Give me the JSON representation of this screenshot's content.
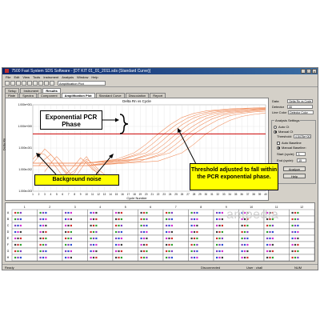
{
  "window": {
    "title": "7500 Fast System SDS Software - [DT KIT 01_01_2011.sds (Standard Curve)]",
    "controls": [
      "_",
      "□",
      "x"
    ]
  },
  "menu": [
    "File",
    "Edit",
    "View",
    "Tools",
    "Instrument",
    "Analysis",
    "Window",
    "Help"
  ],
  "toolbar": {
    "combo_value": "Amplification Plot"
  },
  "tabs_row1": [
    "Setup",
    "Instrument",
    "Results"
  ],
  "tabs_row2": [
    "Plate",
    "Spectra",
    "Component",
    "Amplification Plot",
    "Standard Curve",
    "Dissociation",
    "Report"
  ],
  "active_tab": "Amplification Plot",
  "chart_data": {
    "type": "line",
    "title": "Delta Rn vs Cycle",
    "xlabel": "Cycle Number",
    "ylabel": "Delta Rn",
    "y_scale": "log",
    "ylim": [
      0.001,
      10
    ],
    "y_ticks": [
      "1.000e+001",
      "1.000e+000",
      "1.000e-001",
      "1.000e-002",
      "1.000e-003"
    ],
    "x_ticks": [
      1,
      2,
      3,
      4,
      5,
      6,
      7,
      8,
      9,
      10,
      11,
      12,
      13,
      14,
      15,
      16,
      17,
      18,
      19,
      20,
      21,
      22,
      23,
      24,
      25,
      26,
      27,
      28,
      29,
      30,
      31,
      32,
      33,
      34,
      35,
      36,
      37,
      38,
      39,
      40
    ],
    "threshold": 0.45,
    "threshold_color": "#cc0000",
    "curve_color": "#f09060",
    "grid": true,
    "series": [
      {
        "x": [
          1,
          5,
          10,
          15,
          18,
          20,
          22,
          24,
          26,
          28,
          30,
          34,
          38,
          40
        ],
        "y": [
          0.02,
          0.02,
          0.02,
          0.03,
          0.06,
          0.15,
          0.45,
          1.2,
          2.6,
          4.0,
          5.2,
          6.5,
          7.2,
          7.4
        ]
      },
      {
        "x": [
          1,
          5,
          10,
          15,
          19,
          21,
          23,
          25,
          27,
          29,
          31,
          35,
          38,
          40
        ],
        "y": [
          0.015,
          0.015,
          0.015,
          0.025,
          0.06,
          0.15,
          0.45,
          1.2,
          2.5,
          3.9,
          5.0,
          6.3,
          7.0,
          7.2
        ]
      },
      {
        "x": [
          1,
          5,
          10,
          16,
          20,
          22,
          24,
          26,
          28,
          30,
          32,
          36,
          40
        ],
        "y": [
          0.02,
          0.02,
          0.02,
          0.03,
          0.06,
          0.15,
          0.45,
          1.2,
          2.5,
          3.8,
          4.8,
          6.0,
          6.9
        ]
      },
      {
        "x": [
          1,
          5,
          10,
          17,
          21,
          23,
          25,
          27,
          29,
          31,
          33,
          37,
          40
        ],
        "y": [
          0.015,
          0.015,
          0.015,
          0.025,
          0.06,
          0.15,
          0.45,
          1.2,
          2.4,
          3.7,
          4.7,
          5.9,
          6.6
        ]
      },
      {
        "x": [
          1,
          5,
          10,
          18,
          22,
          24,
          26,
          28,
          30,
          32,
          34,
          38,
          40
        ],
        "y": [
          0.02,
          0.02,
          0.02,
          0.03,
          0.06,
          0.15,
          0.45,
          1.1,
          2.3,
          3.5,
          4.5,
          5.6,
          6.2
        ]
      },
      {
        "x": [
          1,
          5,
          10,
          19,
          23,
          25,
          27,
          29,
          31,
          33,
          35,
          38,
          40
        ],
        "y": [
          0.015,
          0.015,
          0.015,
          0.025,
          0.06,
          0.15,
          0.45,
          1.1,
          2.2,
          3.4,
          4.3,
          5.2,
          5.7
        ]
      },
      {
        "x": [
          1,
          5,
          10,
          20,
          24,
          26,
          28,
          30,
          32,
          34,
          36,
          38,
          40
        ],
        "y": [
          0.02,
          0.02,
          0.02,
          0.03,
          0.06,
          0.15,
          0.45,
          1.0,
          2.0,
          3.1,
          4.0,
          4.7,
          5.1
        ]
      },
      {
        "x": [
          1,
          5,
          10,
          22,
          26,
          28,
          30,
          32,
          34,
          36,
          38,
          40
        ],
        "y": [
          0.015,
          0.015,
          0.015,
          0.025,
          0.06,
          0.15,
          0.45,
          1.0,
          1.9,
          2.9,
          3.6,
          4.2
        ]
      },
      {
        "x": [
          1,
          2,
          3,
          4,
          5,
          6,
          7,
          8,
          9,
          10,
          11,
          12,
          13
        ],
        "y": [
          0.02,
          0.04,
          0.09,
          0.05,
          0.025,
          0.012,
          0.006,
          0.009,
          0.018,
          0.03,
          0.02,
          0.01,
          0.006
        ]
      },
      {
        "x": [
          1,
          2,
          3,
          4,
          5,
          6,
          7,
          8,
          9,
          10,
          11,
          12,
          13
        ],
        "y": [
          0.03,
          0.06,
          0.05,
          0.025,
          0.012,
          0.005,
          0.008,
          0.016,
          0.035,
          0.02,
          0.01,
          0.007,
          0.004
        ]
      },
      {
        "x": [
          2,
          3,
          4,
          5,
          6,
          7,
          8,
          9,
          10,
          11,
          12
        ],
        "y": [
          0.015,
          0.03,
          0.05,
          0.025,
          0.01,
          0.005,
          0.007,
          0.02,
          0.04,
          0.015,
          0.008
        ]
      },
      {
        "x": [
          3,
          4,
          5,
          6,
          7,
          8,
          9,
          10,
          11,
          12,
          13
        ],
        "y": [
          0.008,
          0.02,
          0.04,
          0.02,
          0.008,
          0.004,
          0.01,
          0.025,
          0.012,
          0.006,
          0.003
        ]
      }
    ]
  },
  "settings": {
    "data_label": "Data",
    "data_value": "Delta Rn vs Cycle",
    "detector_label": "Detector",
    "detector_value": "All",
    "line_color_label": "Line Color",
    "line_color_value": "Detector Color",
    "analysis_title": "Analysis Settings",
    "auto_ct": "Auto Ct",
    "manual_ct": "Manual Ct",
    "threshold_label": "Threshold:",
    "threshold_value": "4.5478e+001",
    "auto_baseline": "Auto Baseline",
    "manual_baseline": "Manual Baseline:",
    "start_label": "Start (cycle):",
    "start_value": "3",
    "end_label": "End (cycle):",
    "end_value": "15",
    "analyze_button": "Analyze",
    "help_button": "Help"
  },
  "plate": {
    "columns": [
      "1",
      "2",
      "3",
      "4",
      "5",
      "6",
      "7",
      "8",
      "9",
      "10",
      "11",
      "12"
    ],
    "rows": [
      "A",
      "B",
      "C",
      "D",
      "E",
      "F",
      "G",
      "H"
    ],
    "well_colors": [
      "#d03030",
      "#30a030",
      "#8040c0",
      "#3050d0",
      "#d030d0",
      "#404040"
    ]
  },
  "status": {
    "left": "Ready",
    "middle": "Disconnected",
    "right1": "User : chall",
    "right2": "NUM"
  },
  "callouts": {
    "exponential": "Exponential PCR Phase",
    "background": "Background noise",
    "threshold": "Threshold adjusted to fall within the PCR exponential phase."
  },
  "watermark": "antpedia"
}
